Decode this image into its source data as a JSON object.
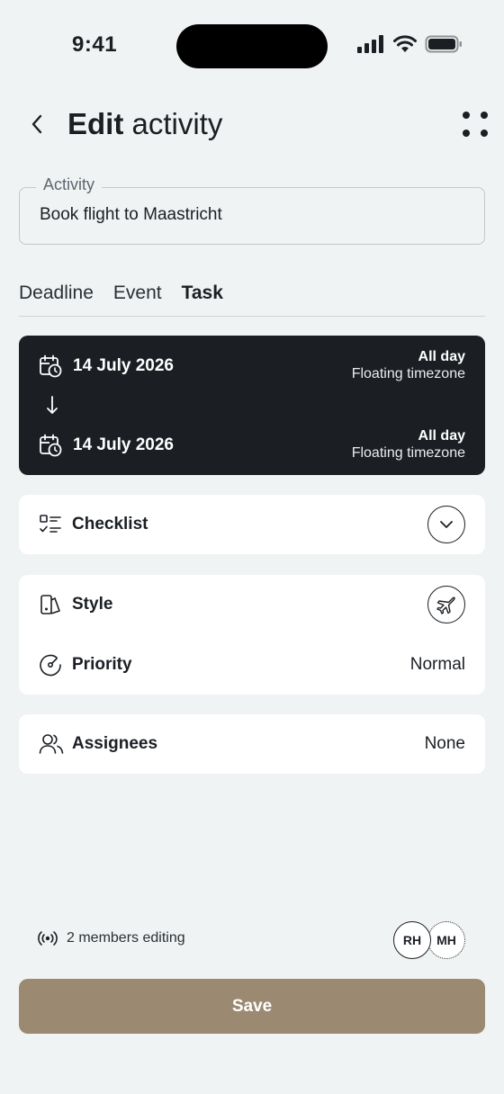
{
  "status_bar": {
    "time": "9:41"
  },
  "header": {
    "title_strong": "Edit",
    "title_light": "activity"
  },
  "activity": {
    "label": "Activity",
    "value": "Book flight to Maastricht"
  },
  "tabs": [
    {
      "label": "Deadline",
      "active": false
    },
    {
      "label": "Event",
      "active": false
    },
    {
      "label": "Task",
      "active": true
    }
  ],
  "dates": {
    "start": {
      "date": "14 July 2026",
      "all_day": "All day",
      "timezone": "Floating timezone"
    },
    "end": {
      "date": "14 July 2026",
      "all_day": "All day",
      "timezone": "Floating timezone"
    }
  },
  "checklist": {
    "label": "Checklist",
    "icon": "checklist-icon",
    "action_icon": "chevron-down-icon"
  },
  "style": {
    "label": "Style",
    "icon": "style-icon",
    "value_icon": "airplane-icon"
  },
  "priority": {
    "label": "Priority",
    "value": "Normal",
    "icon": "gauge-icon"
  },
  "assignees": {
    "label": "Assignees",
    "value": "None",
    "icon": "users-icon"
  },
  "footer": {
    "editing_text": "2 members editing",
    "avatars": [
      "RH",
      "MH"
    ],
    "save_label": "Save"
  },
  "colors": {
    "background": "#eff3f3",
    "dark_card": "#1b1f24",
    "save_button": "#9b8a71",
    "text": "#1b1f24"
  }
}
